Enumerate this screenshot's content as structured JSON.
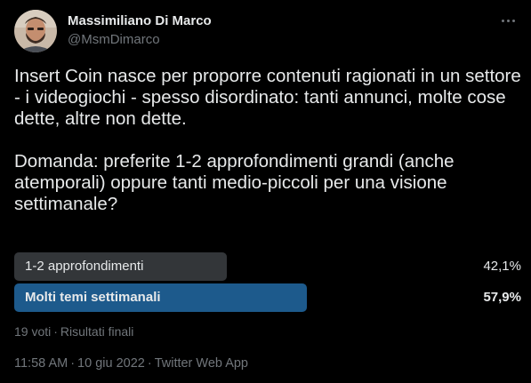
{
  "author": {
    "name": "Massimiliano Di Marco",
    "handle": "@MsmDimarco"
  },
  "icons": {
    "avatar": "user-avatar-photo",
    "more": "more-options-icon"
  },
  "tweet": {
    "paragraph_1": "Insert Coin nasce per proporre contenuti ragionati in un settore - i videogiochi - spesso disordinato: tanti annunci, molte cose dette, altre non dette.",
    "paragraph_2": "Domanda: preferite 1-2 approfondimenti grandi (anche atemporali) oppure tanti medio-piccoli per una visione settimanale?"
  },
  "poll": {
    "options": [
      {
        "label": "1-2 approfondimenti",
        "percent": "42,1%",
        "value": 42.1,
        "color": "#333639"
      },
      {
        "label": "Molti temi settimanali",
        "percent": "57,9%",
        "value": 57.9,
        "color": "#1d5a8c"
      }
    ],
    "votes": "19 voti",
    "separator": "·",
    "status": "Risultati finali"
  },
  "footer": {
    "time": "11:58 AM",
    "separator": "·",
    "date": "10 giu 2022",
    "client": "Twitter Web App"
  },
  "colors": {
    "background": "#000000",
    "text": "#e7e9ea",
    "muted": "#71767b",
    "winner_bar": "#1d5a8c",
    "loser_bar": "#333639"
  }
}
